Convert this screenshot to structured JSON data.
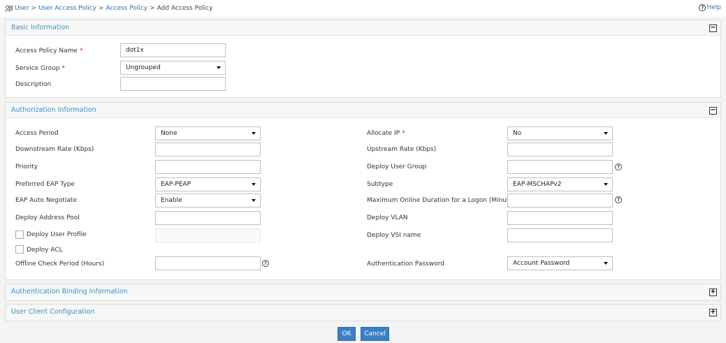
{
  "breadcrumb": {
    "items": [
      "User",
      "User Access Policy",
      "Access Policy"
    ],
    "current": "Add Access Policy"
  },
  "help": {
    "label": "Help"
  },
  "basic": {
    "title": "Basic Information",
    "policy_name_label": "Access Policy Name",
    "policy_name_value": "dot1x",
    "service_group_label": "Service Group",
    "service_group_value": "Ungrouped",
    "description_label": "Description",
    "description_value": ""
  },
  "auth": {
    "title": "Authorization Information",
    "access_period_label": "Access Period",
    "access_period_value": "None",
    "allocate_ip_label": "Allocate IP",
    "allocate_ip_value": "No",
    "downstream_label": "Downstream Rate (Kbps)",
    "upstream_label": "Upstream Rate (Kbps)",
    "priority_label": "Priority",
    "deploy_user_group_label": "Deploy User Group",
    "eap_type_label": "Preferred EAP Type",
    "eap_type_value": "EAP-PEAP",
    "subtype_label": "Subtype",
    "subtype_value": "EAP-MSCHAPv2",
    "eap_negotiate_label": "EAP Auto Negotiate",
    "eap_negotiate_value": "Enable",
    "max_duration_label": "Maximum Online Duration for a Logon (Minutes)",
    "address_pool_label": "Deploy Address Pool",
    "vlan_label": "Deploy VLAN",
    "user_profile_label": "Deploy User Profile",
    "vsi_label": "Deploy VSI name",
    "acl_label": "Deploy ACL",
    "offline_label": "Offline Check Period (Hours)",
    "auth_password_label": "Authentication Password",
    "auth_password_value": "Account Password"
  },
  "binding": {
    "title": "Authentication Binding Information"
  },
  "client": {
    "title": "User Client Configuration"
  },
  "actions": {
    "ok": "OK",
    "cancel": "Cancel"
  },
  "glyphs": {
    "minus": "−",
    "plus": "+",
    "question": "?"
  }
}
